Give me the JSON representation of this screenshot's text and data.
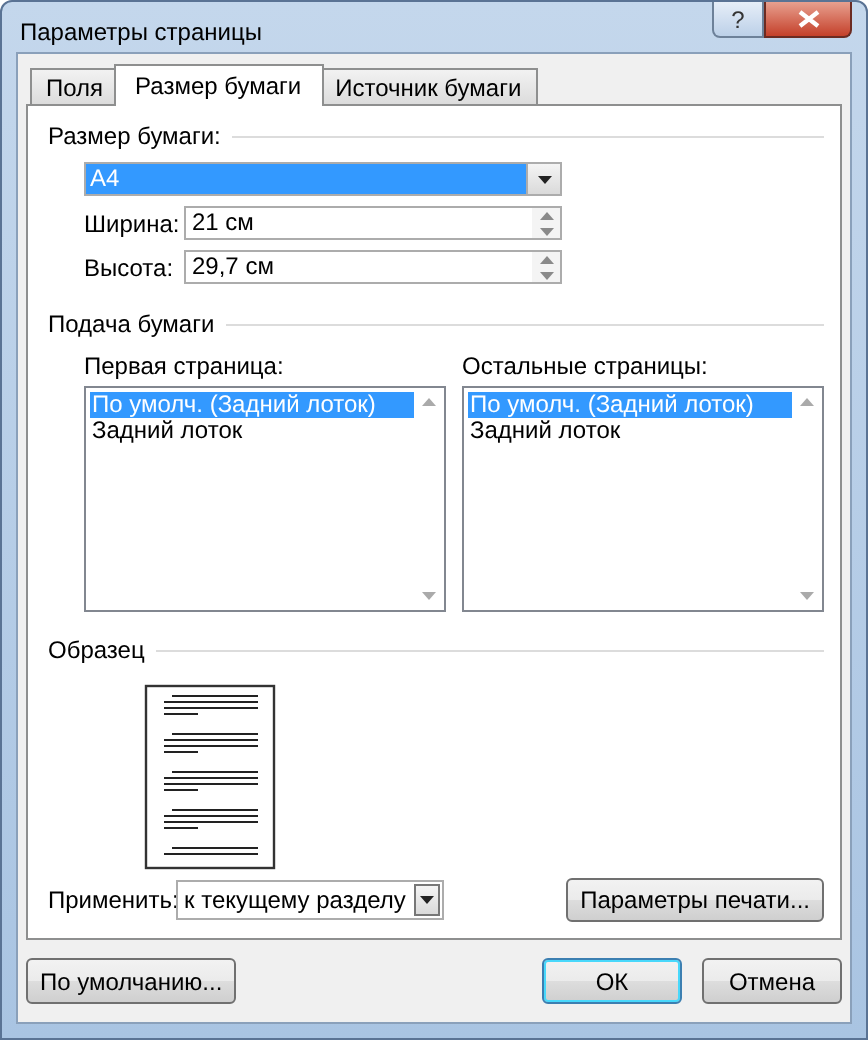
{
  "window": {
    "title": "Параметры страницы",
    "help": "?"
  },
  "tabs": [
    {
      "label": "Поля",
      "selected": false
    },
    {
      "label": "Размер бумаги",
      "selected": true
    },
    {
      "label": "Источник бумаги",
      "selected": false
    }
  ],
  "paper_size": {
    "heading": "Размер бумаги:",
    "value": "A4",
    "width": {
      "label": "Ширина:",
      "value": "21 см"
    },
    "height": {
      "label": "Высота:",
      "value": "29,7 см"
    }
  },
  "paper_source": {
    "heading": "Подача бумаги",
    "lists": [
      {
        "label": "Первая страница:",
        "items": [
          {
            "text": "По умолч. (Задний лоток)",
            "selected": true
          },
          {
            "text": "Задний лоток",
            "selected": false
          }
        ]
      },
      {
        "label": "Остальные страницы:",
        "items": [
          {
            "text": "По умолч. (Задний лоток)",
            "selected": true
          },
          {
            "text": "Задний лоток",
            "selected": false
          }
        ]
      }
    ]
  },
  "preview": {
    "heading": "Образец"
  },
  "apply": {
    "label": "Применить:",
    "value": "к текущему разделу"
  },
  "print_options_button": "Параметры печати...",
  "buttons": [
    {
      "label": "По умолчанию...",
      "default": false
    },
    {
      "label": "ОК",
      "default": true
    },
    {
      "label": "Отмена",
      "default": false
    }
  ]
}
